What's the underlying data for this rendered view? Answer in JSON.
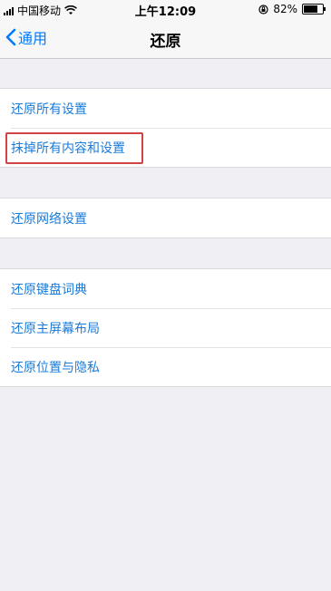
{
  "status_bar": {
    "carrier": "中国移动",
    "time": "上午12:09",
    "battery_percent": "82%",
    "battery_level": 0.82,
    "icons": [
      "signal-icon",
      "wifi-icon",
      "orientation-lock-icon",
      "battery-icon"
    ]
  },
  "nav": {
    "back_label": "通用",
    "title": "还原"
  },
  "groups": [
    {
      "items": [
        "还原所有设置",
        "抹掉所有内容和设置"
      ]
    },
    {
      "items": [
        "还原网络设置"
      ]
    },
    {
      "items": [
        "还原键盘词典",
        "还原主屏幕布局",
        "还原位置与隐私"
      ]
    }
  ],
  "colors": {
    "accent": "#007aff",
    "link_text": "#1a7bd8",
    "highlight": "#d14444",
    "background": "#efeff4"
  }
}
